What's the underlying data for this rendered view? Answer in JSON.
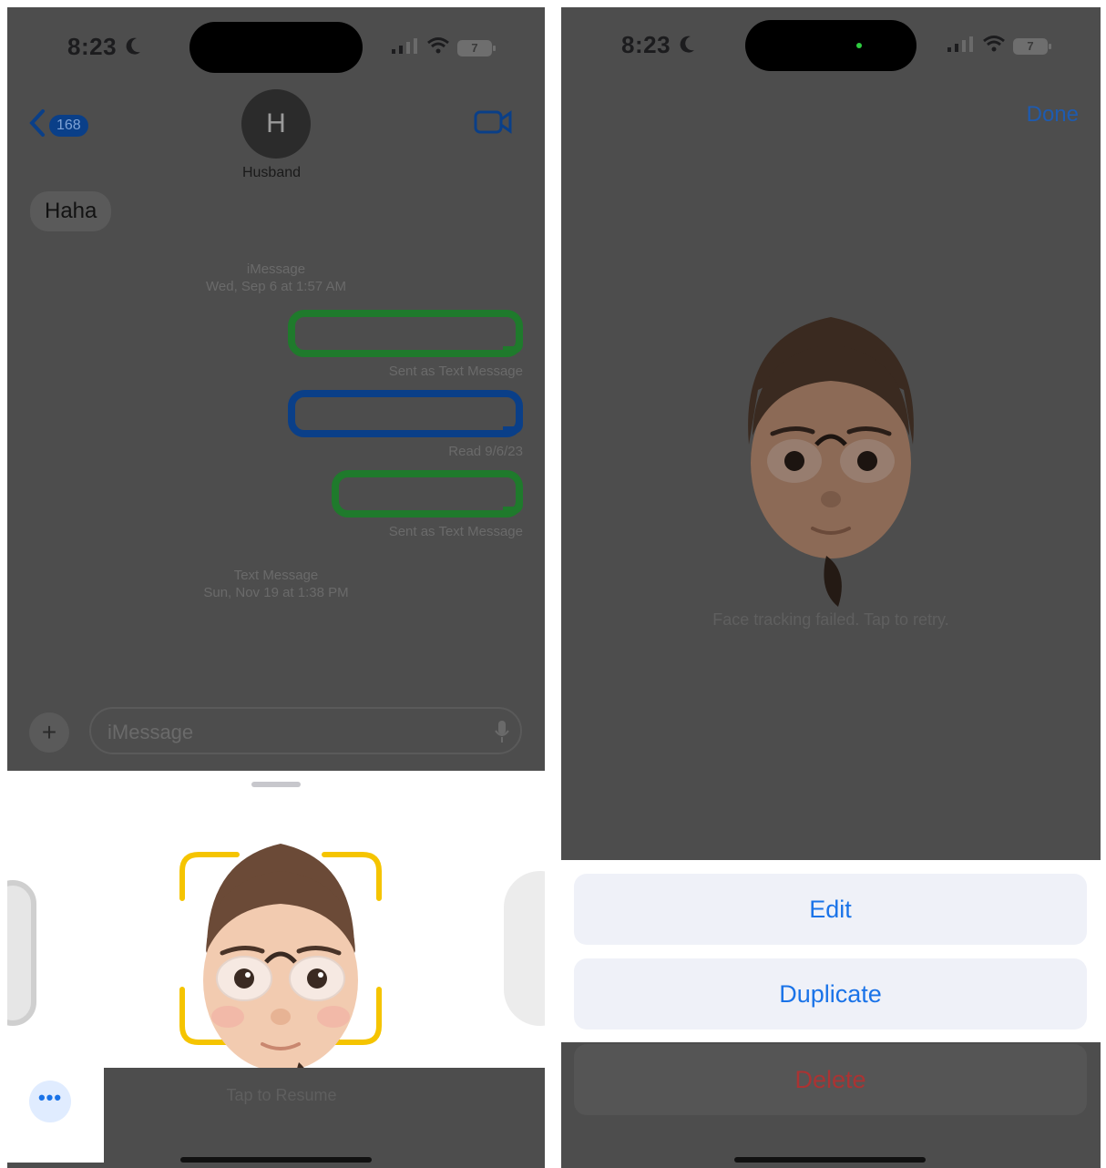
{
  "left_screen": {
    "status": {
      "time": "8:23"
    },
    "header": {
      "back_count": "168",
      "contact_initial": "H",
      "contact_name": "Husband"
    },
    "messages": {
      "incoming_text": "Haha",
      "meta_1": {
        "service": "iMessage",
        "timestamp": "Wed, Sep 6 at 1:57 AM"
      },
      "status_1": "Sent as Text Message",
      "status_2": "Read 9/6/23",
      "status_3": "Sent as Text Message",
      "meta_2": {
        "service": "Text Message",
        "timestamp": "Sun, Nov 19 at 1:38 PM"
      }
    },
    "input": {
      "placeholder": "iMessage",
      "plus_icon": "plus-icon",
      "mic_icon": "mic-icon"
    },
    "sheet": {
      "resume_label": "Tap to Resume",
      "more_label": "•••"
    },
    "colors": {
      "green_bubble": "#1f7a2c",
      "blue_bubble": "#0a3f88",
      "frame": "#f5c400"
    }
  },
  "right_screen": {
    "status": {
      "time": "8:23"
    },
    "header": {
      "done_label": "Done"
    },
    "tracking_message": "Face tracking failed. Tap to retry.",
    "actions": {
      "edit": "Edit",
      "duplicate": "Duplicate",
      "delete": "Delete"
    },
    "colors": {
      "accent": "#1a73e8",
      "delete": "#a33333"
    }
  }
}
